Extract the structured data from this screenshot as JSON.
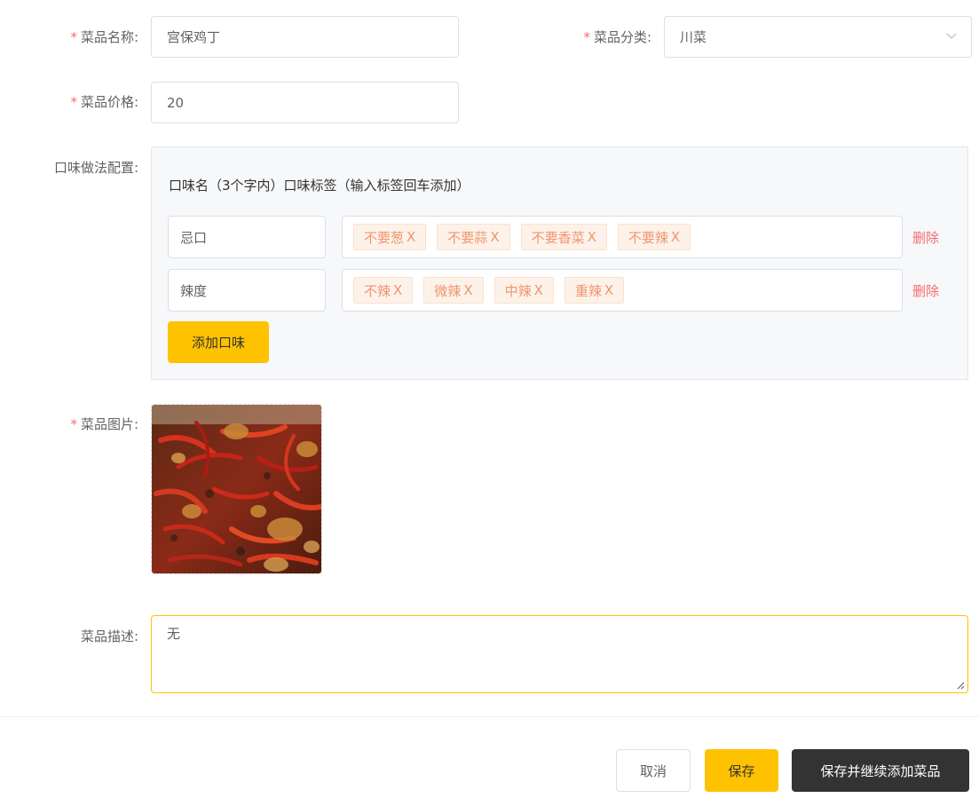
{
  "form": {
    "dish_name": {
      "label": "菜品名称:",
      "value": "宫保鸡丁",
      "required": true
    },
    "category": {
      "label": "菜品分类:",
      "value": "川菜",
      "required": true
    },
    "price": {
      "label": "菜品价格:",
      "value": "20",
      "required": true
    },
    "flavor": {
      "label": "口味做法配置:",
      "header": "口味名（3个字内）口味标签（输入标签回车添加）",
      "rows": [
        {
          "name": "忌口",
          "tags": [
            "不要葱",
            "不要蒜",
            "不要香菜",
            "不要辣"
          ],
          "delete_label": "删除"
        },
        {
          "name": "辣度",
          "tags": [
            "不辣",
            "微辣",
            "中辣",
            "重辣"
          ],
          "delete_label": "删除"
        }
      ],
      "tag_remove_symbol": "X",
      "add_label": "添加口味"
    },
    "image": {
      "label": "菜品图片:",
      "required": true
    },
    "description": {
      "label": "菜品描述:",
      "value": "无"
    }
  },
  "required_mark": "*",
  "actions": {
    "cancel": "取消",
    "save": "保存",
    "save_continue": "保存并继续添加菜品"
  },
  "colors": {
    "accent": "#ffc200",
    "danger": "#f56c6c",
    "tag_text": "#f0956e",
    "tag_bg": "#fdf2e9",
    "dark_button": "#333333"
  }
}
